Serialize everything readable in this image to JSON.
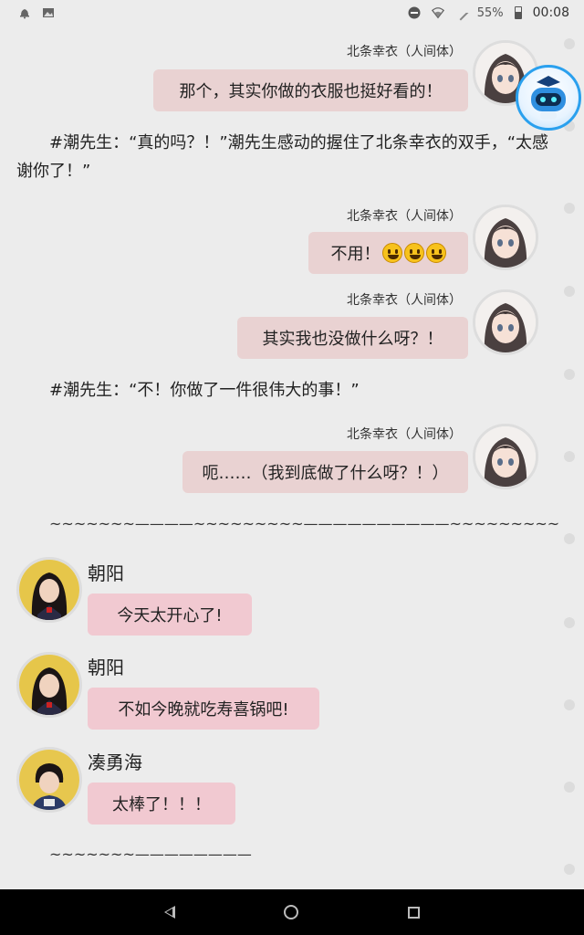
{
  "status_bar": {
    "battery_percent": "55%",
    "time": "00:08"
  },
  "messages": [
    {
      "type": "right",
      "name": "北条幸衣（人间体）",
      "text": "那个，其实你做的衣服也挺好看的！"
    },
    {
      "type": "narration",
      "text": "#潮先生：“真的吗？！”潮先生感动的握住了北条幸衣的双手，“太感谢你了！”"
    },
    {
      "type": "right",
      "name": "北条幸衣（人间体）",
      "text": "不用！"
    },
    {
      "type": "right",
      "name": "北条幸衣（人间体）",
      "text": "其实我也没做什么呀？！"
    },
    {
      "type": "narration",
      "text": "#潮先生：“不！你做了一件很伟大的事！”"
    },
    {
      "type": "right",
      "name": "北条幸衣（人间体）",
      "text": "呃……（我到底做了什么呀？！）"
    },
    {
      "type": "separator",
      "text": "~~~~~~~————~~~~~~~~~——————————~~~~~~~~~"
    },
    {
      "type": "left",
      "name": "朝阳",
      "text": "今天太开心了!"
    },
    {
      "type": "left",
      "name": "朝阳",
      "text": "不如今晚就吃寿喜锅吧!"
    },
    {
      "type": "left",
      "name": "凑勇海",
      "text": "太棒了！！！"
    },
    {
      "type": "separator",
      "text": "~~~~~~~————————"
    }
  ],
  "icons": {
    "emoji": "grinning-face-emoji",
    "robot": "robot-assistant-icon"
  }
}
